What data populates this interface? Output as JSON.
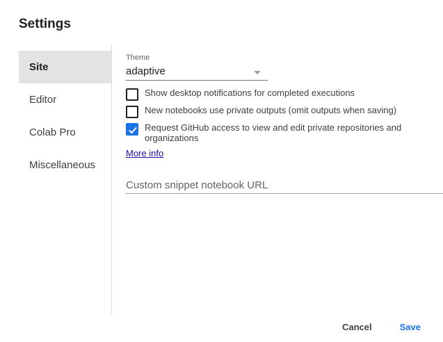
{
  "dialog": {
    "title": "Settings"
  },
  "sidebar": {
    "items": [
      {
        "label": "Site",
        "active": true
      },
      {
        "label": "Editor",
        "active": false
      },
      {
        "label": "Colab Pro",
        "active": false
      },
      {
        "label": "Miscellaneous",
        "active": false
      }
    ]
  },
  "site": {
    "theme_label": "Theme",
    "theme_value": "adaptive",
    "checkboxes": [
      {
        "label": "Show desktop notifications for completed executions",
        "checked": false
      },
      {
        "label": "New notebooks use private outputs (omit outputs when saving)",
        "checked": false
      },
      {
        "label": "Request GitHub access to view and edit private repositories and organizations",
        "checked": true
      }
    ],
    "more_info_label": "More info",
    "snippet_url": {
      "value": "",
      "placeholder": "Custom snippet notebook URL"
    }
  },
  "actions": {
    "cancel_label": "Cancel",
    "save_label": "Save"
  },
  "colors": {
    "accent": "#1a73e8",
    "active_tab_bg": "#e3e3e3",
    "link": "#1a0dab"
  }
}
